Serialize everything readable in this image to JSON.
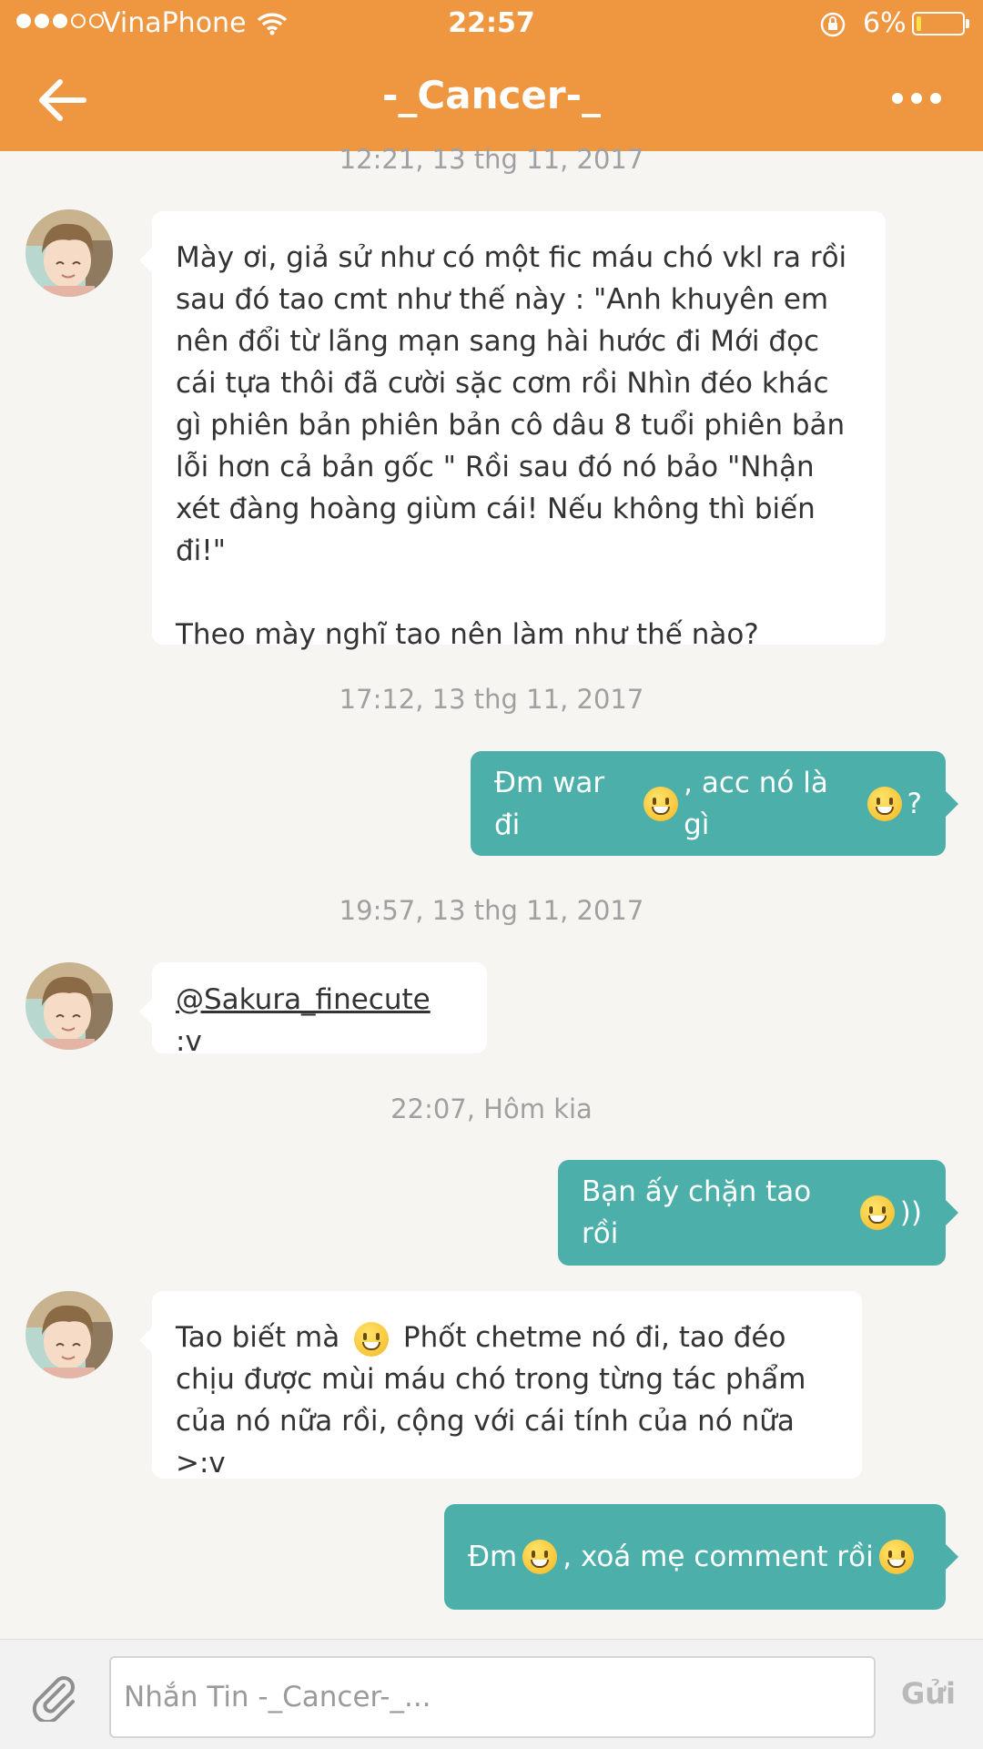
{
  "status_bar": {
    "carrier": "VinaPhone",
    "time": "22:57",
    "battery_percent": "6%",
    "signal_bars_filled": 3,
    "signal_bars_total": 5,
    "battery_level": 0.06,
    "battery_color": "#ffe14a"
  },
  "header": {
    "title": "-_Cancer-_",
    "back_icon": "arrow-left-icon",
    "more_icon": "more-horizontal-icon",
    "color": "#ef9641"
  },
  "messages": {
    "m1": {
      "timestamp": "12:21, 13 thg 11, 2017",
      "direction": "incoming",
      "text": "Mày ơi, giả sử như có một fic máu chó vkl ra rồi sau đó tao cmt như thế này : \"Anh khuyên em nên đổi từ lãng mạn sang hài hước đi  Mới đọc cái tựa thôi đã cười sặc cơm rồi  Nhìn đéo khác gì phiên bản phiên bản cô dâu 8 tuổi phiên bản lỗi hơn cả bản gốc \" Rồi sau đó nó bảo \"Nhận xét đàng hoàng giùm cái! Nếu không thì biến đi!\"",
      "text2": "Theo mày nghĩ tao nên làm như thế nào?"
    },
    "m2": {
      "timestamp": "17:12, 13 thg 11, 2017",
      "direction": "outgoing",
      "part1": "Đm war đi",
      "part2": ", acc nó là gì",
      "part3": "?"
    },
    "m3": {
      "timestamp": "19:57, 13 thg 11, 2017",
      "direction": "incoming",
      "mention": "@Sakura_finecute",
      "text": " :v"
    },
    "m4": {
      "timestamp": "22:07, Hôm kia",
      "direction": "outgoing",
      "part1": "Bạn ấy chặn tao rồi",
      "part2": "))"
    },
    "m5": {
      "direction": "incoming",
      "part1": "Tao biết mà",
      "part2": " Phốt chetme nó đi, tao đéo chịu được mùi máu chó trong từng tác phẩm của nó nữa rồi, cộng với cái tính của nó nữa >:v"
    },
    "m6": {
      "direction": "outgoing",
      "part1": "Đm",
      "part2": ", xoá mẹ comment rồi"
    }
  },
  "emoji_icon": "grinning-face-icon",
  "composer": {
    "attach_icon": "paperclip-icon",
    "placeholder": "Nhắn Tin -_Cancer-_...",
    "value": "",
    "send_label": "Gửi"
  },
  "colors": {
    "outgoing_bubble": "#4dafa9",
    "incoming_bubble": "#ffffff",
    "background": "#f6f5f2"
  }
}
